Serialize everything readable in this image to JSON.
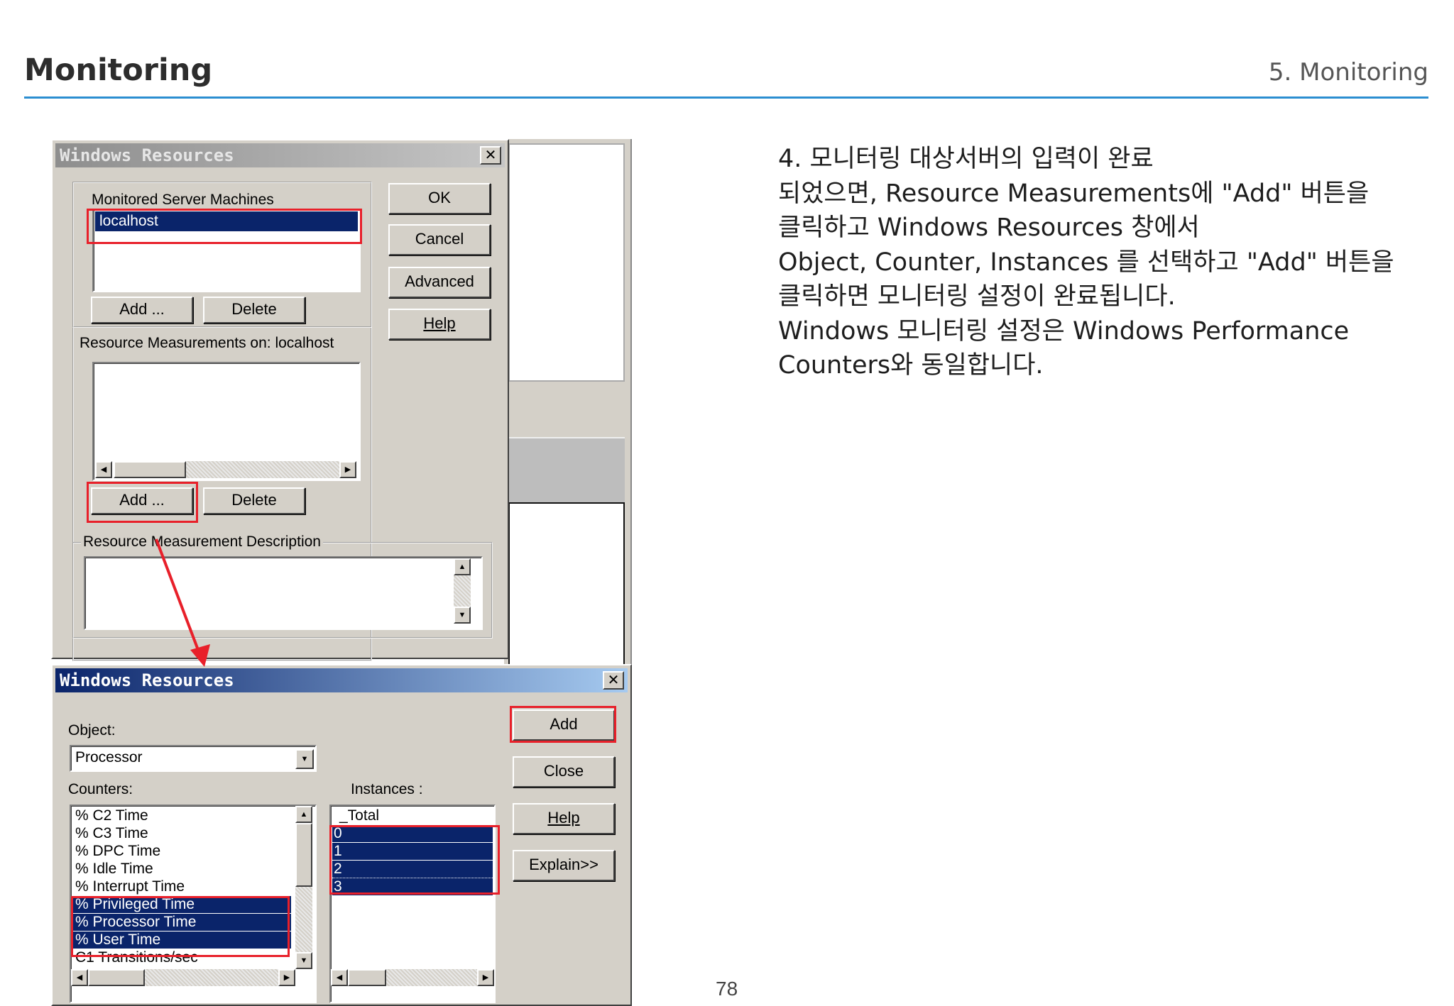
{
  "header": {
    "title": "Monitoring",
    "section": "5. Monitoring"
  },
  "description": [
    "4. 모니터링 대상서버의 입력이 완료",
    "되었으면, Resource Measurements에 \"Add\" 버튼을",
    "클릭하고 Windows Resources 창에서",
    "Object, Counter, Instances 를 선택하고 \"Add\" 버튼을",
    "클릭하면 모니터링 설정이 완료됩니다.",
    "Windows 모니터링 설정은 Windows Performance",
    "Counters와 동일합니다."
  ],
  "page_number": "78",
  "dialog1": {
    "title": "Windows Resources",
    "close_glyph": "✕",
    "monitored_label": "Monitored Server Machines",
    "machines": [
      "localhost"
    ],
    "add_label": "Add ...",
    "delete_label": "Delete",
    "measurements_label": "Resource Measurements on: localhost",
    "add2_label": "Add ...",
    "delete2_label": "Delete",
    "description_label": "Resource Measurement Description",
    "ok_label": "OK",
    "cancel_label": "Cancel",
    "advanced_label": "Advanced",
    "help_label": "Help"
  },
  "dialog2": {
    "title": "Windows Resources",
    "close_glyph": "✕",
    "object_label": "Object:",
    "object_value": "Processor",
    "counters_label": "Counters:",
    "counters": [
      "% C2 Time",
      "% C3 Time",
      "% DPC Time",
      "% Idle Time",
      "% Interrupt Time",
      "% Privileged Time",
      "% Processor Time",
      "% User Time",
      "C1 Transitions/sec"
    ],
    "counters_selected": [
      false,
      false,
      false,
      false,
      false,
      true,
      true,
      true,
      false
    ],
    "instances_label": "Instances :",
    "instances": [
      "_Total",
      "0",
      "1",
      "2",
      "3"
    ],
    "instances_selected": [
      false,
      true,
      true,
      true,
      true
    ],
    "add_label": "Add",
    "close_label": "Close",
    "help_label": "Help",
    "explain_label": "Explain>>"
  },
  "colors": {
    "accent_rule": "#2b8ed1",
    "highlight_box": "#e8202a",
    "selection": "#0a246a",
    "dialog_face": "#d4d0c8"
  }
}
